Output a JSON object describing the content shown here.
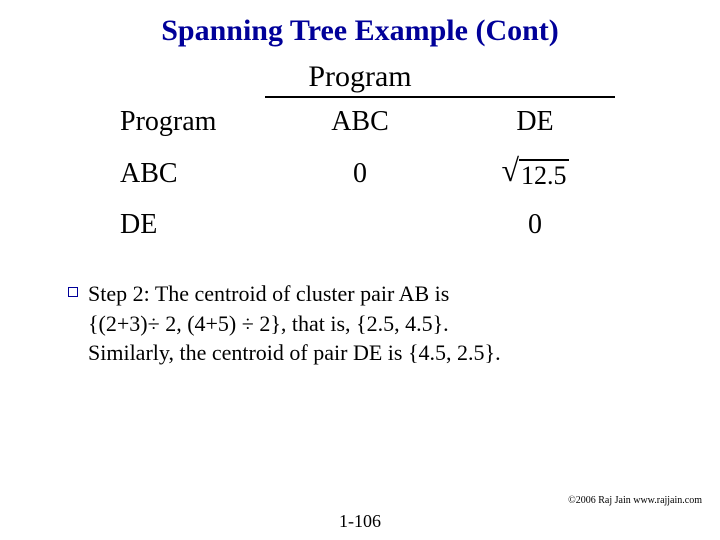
{
  "title": "Spanning Tree Example (Cont)",
  "matrix": {
    "top_label": "Program",
    "rows": [
      {
        "left": "Program",
        "mid": "ABC",
        "right": "DE"
      },
      {
        "left": "ABC",
        "mid": "0",
        "right_sqrt": "12.5"
      },
      {
        "left": "DE",
        "mid": "",
        "right": "0"
      }
    ]
  },
  "step": {
    "line1": "Step 2: The centroid of cluster pair AB is",
    "line2": "{(2+3)÷ 2, (4+5) ÷ 2}, that is, {2.5, 4.5}.",
    "line3": "Similarly, the centroid of pair DE is {4.5, 2.5}."
  },
  "copyright": "©2006 Raj Jain www.rajjain.com",
  "page": "1-106"
}
